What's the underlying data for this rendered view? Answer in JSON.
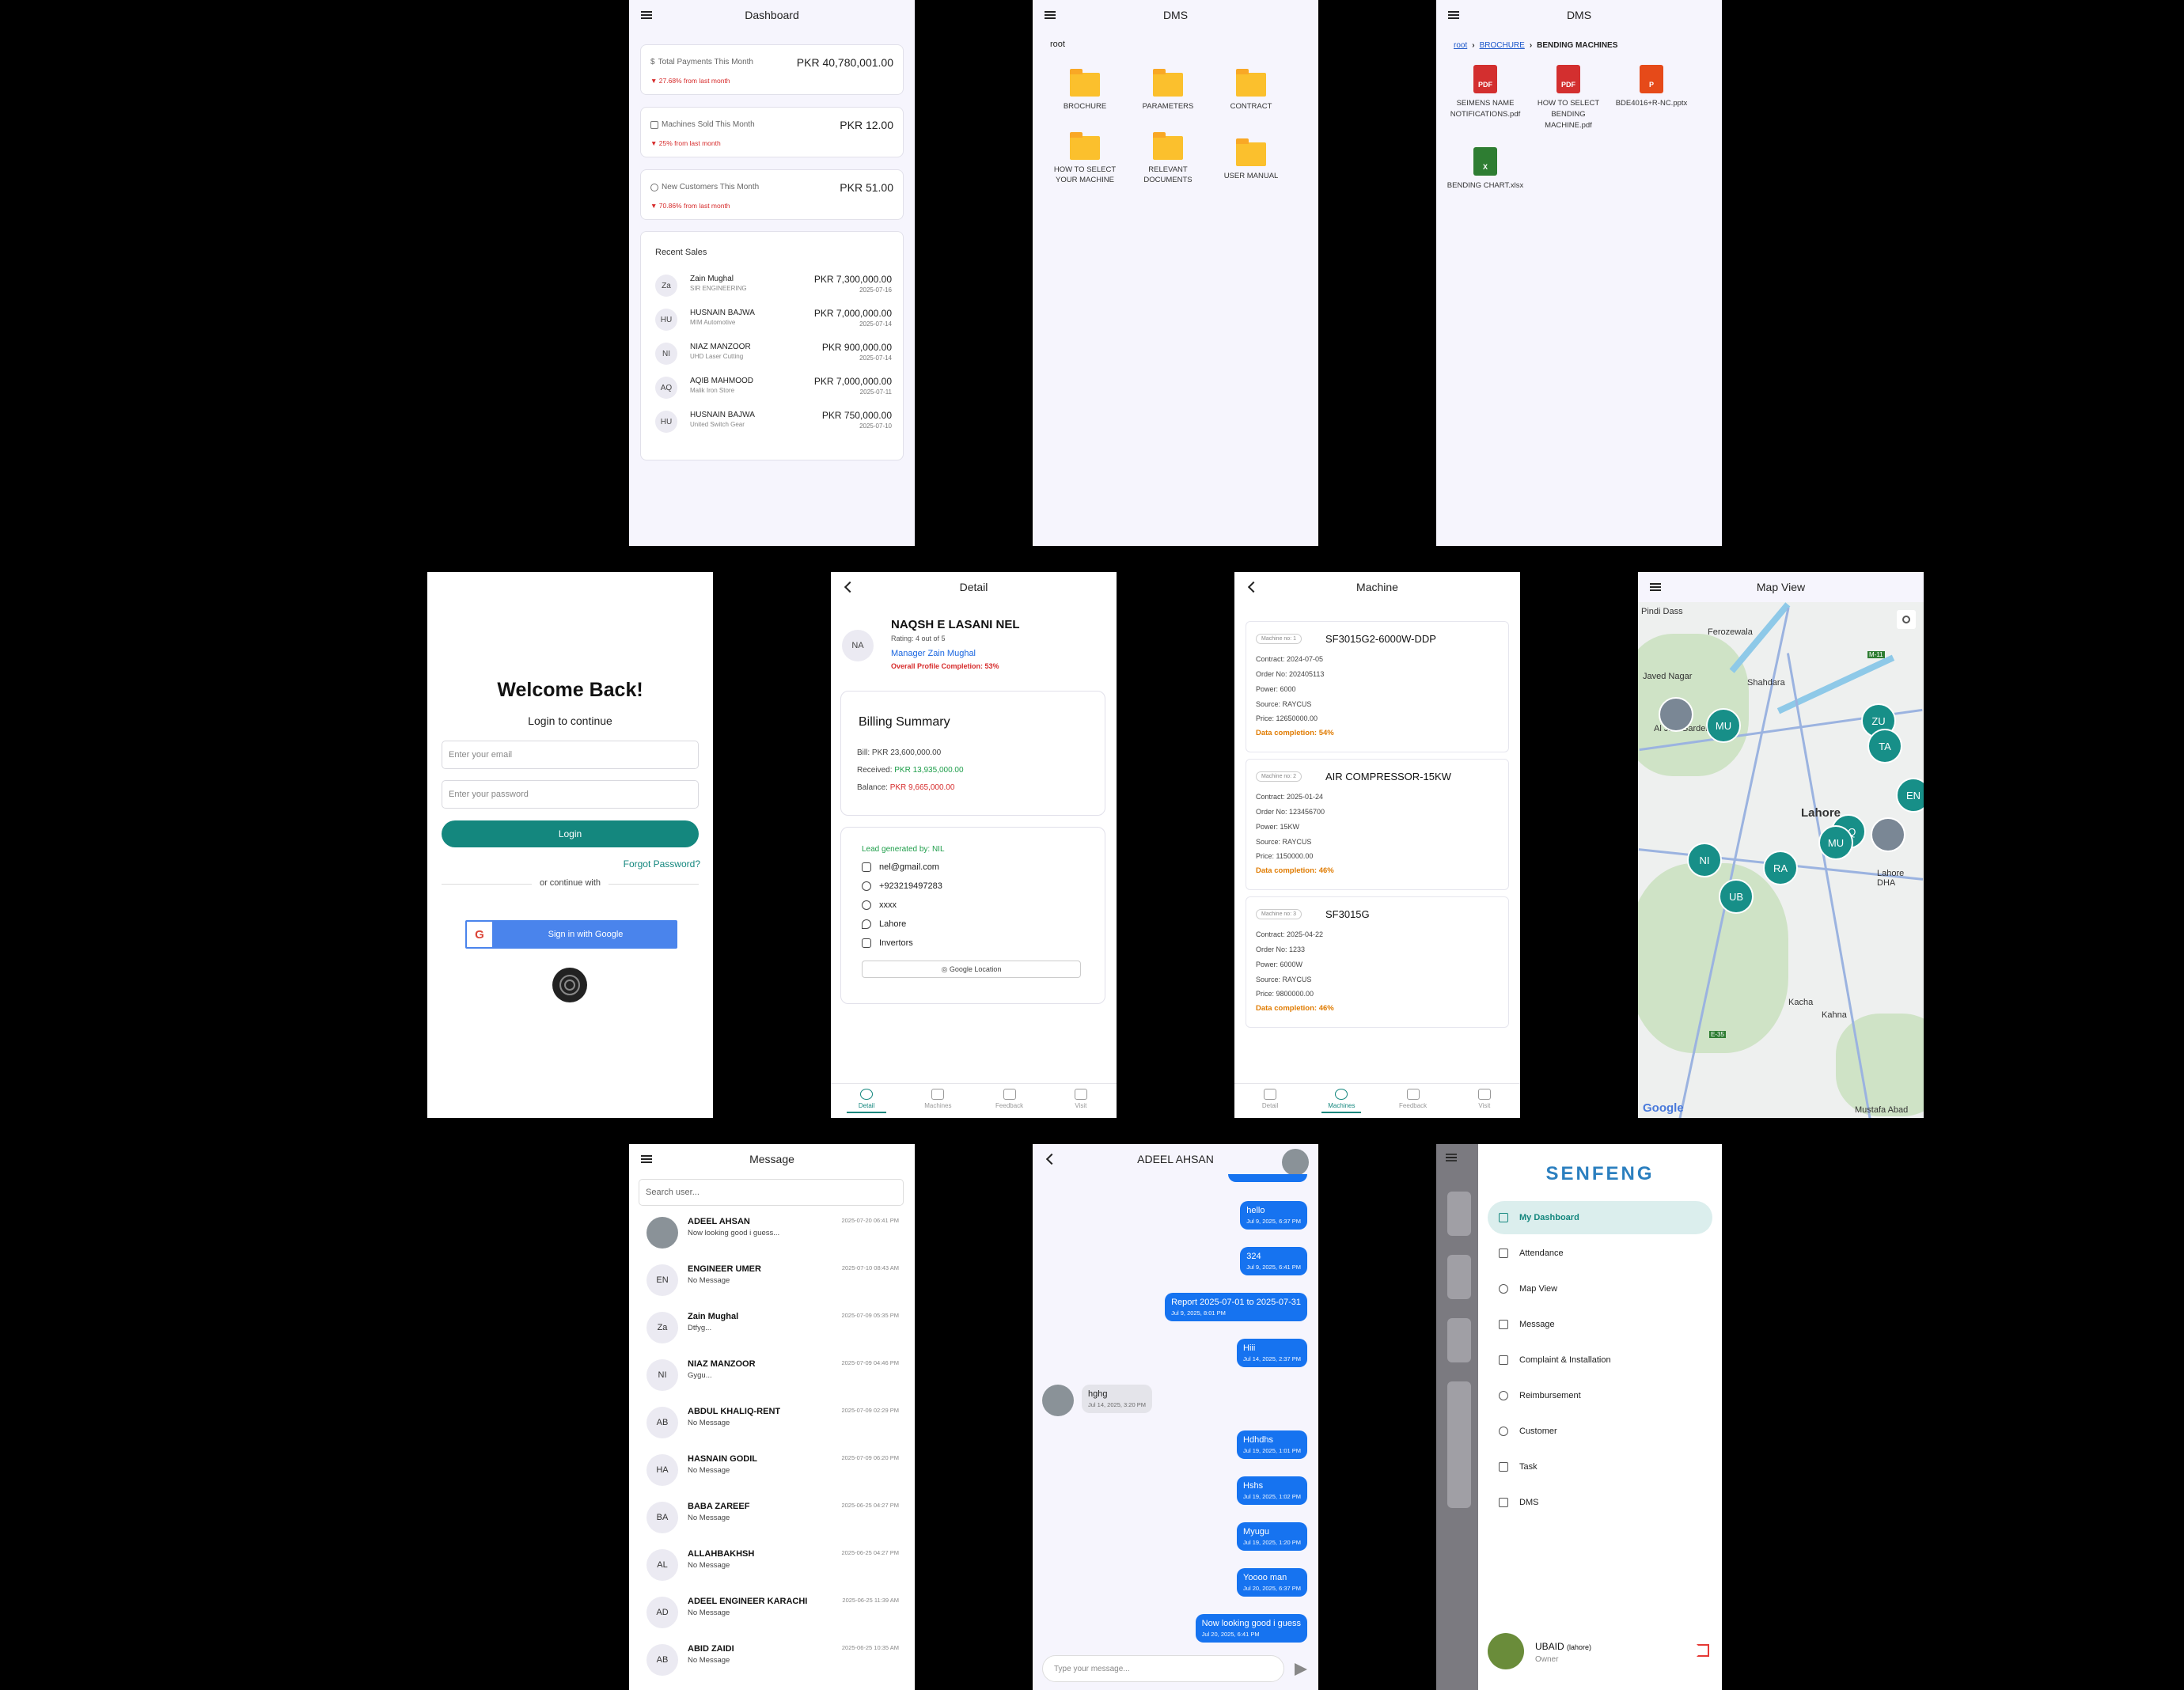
{
  "dashboard": {
    "title": "Dashboard",
    "stats": [
      {
        "label": "Total Payments This Month",
        "value": "PKR 40,780,001.00",
        "change": "▼ 27.68% from last month"
      },
      {
        "label": "Machines Sold This Month",
        "value": "PKR 12.00",
        "change": "▼ 25% from last month"
      },
      {
        "label": "New Customers This Month",
        "value": "PKR 51.00",
        "change": "▼ 70.86% from last month"
      }
    ],
    "recent_title": "Recent Sales",
    "sales": [
      {
        "initials": "Za",
        "name": "Zain Mughal",
        "company": "SIR ENGINEERING",
        "amount": "PKR 7,300,000.00",
        "date": "2025-07-16"
      },
      {
        "initials": "HU",
        "name": "HUSNAIN BAJWA",
        "company": "MIM Automotive",
        "amount": "PKR 7,000,000.00",
        "date": "2025-07-14"
      },
      {
        "initials": "NI",
        "name": "NIAZ MANZOOR",
        "company": "UHD Laser Cutting",
        "amount": "PKR 900,000.00",
        "date": "2025-07-14"
      },
      {
        "initials": "AQ",
        "name": "AQIB MAHMOOD",
        "company": "Malik Iron Store",
        "amount": "PKR 7,000,000.00",
        "date": "2025-07-11"
      },
      {
        "initials": "HU",
        "name": "HUSNAIN BAJWA",
        "company": "United Switch Gear",
        "amount": "PKR 750,000.00",
        "date": "2025-07-10"
      }
    ]
  },
  "dms_root": {
    "title": "DMS",
    "path": "root",
    "folders": [
      "BROCHURE",
      "PARAMETERS",
      "CONTRACT",
      "HOW TO SELECT YOUR MACHINE",
      "RELEVANT DOCUMENTS",
      "USER MANUAL"
    ]
  },
  "dms_folder": {
    "title": "DMS",
    "crumbs": [
      "root",
      "BROCHURE",
      "BENDING MACHINES"
    ],
    "files": [
      {
        "name": "SEIMENS NAME NOTIFICATIONS.pdf",
        "type": "PDF"
      },
      {
        "name": "HOW TO SELECT BENDING MACHINE.pdf",
        "type": "PDF"
      },
      {
        "name": "BDE4016+R-NC.pptx",
        "type": "P"
      },
      {
        "name": "BENDING CHART.xlsx",
        "type": "X"
      }
    ]
  },
  "login": {
    "heading": "Welcome Back!",
    "subheading": "Login to continue",
    "email_placeholder": "Enter your email",
    "password_placeholder": "Enter your password",
    "login_label": "Login",
    "forgot": "Forgot Password?",
    "or": "or continue with",
    "google": "Sign in with Google"
  },
  "detail": {
    "title": "Detail",
    "initials": "NA",
    "name": "NAQSH E LASANI NEL",
    "rating": "Rating: 4 out of 5",
    "manager": "Manager Zain Mughal",
    "completion": "Overall Profile Completion: 53%",
    "billing_title": "Billing Summary",
    "bill_label": "Bill:",
    "bill": "PKR 23,600,000.00",
    "received_label": "Received:",
    "received": "PKR 13,935,000.00",
    "balance_label": "Balance:",
    "balance": "PKR 9,665,000.00",
    "lead": "Lead generated by: NIL",
    "email": "nel@gmail.com",
    "phone": "+923219497283",
    "whatsapp": "xxxx",
    "city": "Lahore",
    "industry": "Invertors",
    "location_btn": "Google Location"
  },
  "tabs": [
    "Detail",
    "Machines",
    "Feedback",
    "Visit"
  ],
  "machines": {
    "title": "Machine",
    "items": [
      {
        "badge": "Machine no: 1",
        "name": "SF3015G2-6000W-DDP",
        "contract": "Contract: 2024-07-05",
        "order": "Order No: 202405113",
        "power": "Power: 6000",
        "source": "Source: RAYCUS",
        "price": "Price: 12650000.00",
        "completion": "Data completion: 54%"
      },
      {
        "badge": "Machine no: 2",
        "name": "AIR COMPRESSOR-15KW",
        "contract": "Contract: 2025-01-24",
        "order": "Order No: 123456700",
        "power": "Power: 15KW",
        "source": "Source: RAYCUS",
        "price": "Price: 1150000.00",
        "completion": "Data completion: 46%"
      },
      {
        "badge": "Machine no: 3",
        "name": "SF3015G",
        "contract": "Contract: 2025-04-22",
        "order": "Order No: 1233",
        "power": "Power: 6000W",
        "source": "Source: RAYCUS",
        "price": "Price: 9800000.00",
        "completion": "Data completion: 46%"
      }
    ]
  },
  "map": {
    "title": "Map View",
    "places": [
      "Pindi Dass",
      "Ferozewala",
      "Shahdara",
      "Javed Nagar",
      "Al Jalil Garden",
      "Lahore",
      "Lahore DHA",
      "Kacha",
      "Kahna",
      "Mustafa Abad",
      "M-11",
      "E-35"
    ],
    "pins": [
      "MU",
      "ZU",
      "TA",
      "EN",
      "AQ",
      "MU",
      "NI",
      "RA",
      "UB"
    ],
    "google": "Google"
  },
  "message": {
    "title": "Message",
    "search_placeholder": "Search user...",
    "chats": [
      {
        "initials": "",
        "name": "ADEEL AHSAN",
        "preview": "Now looking good i guess...",
        "time": "2025-07-20 06:41 PM"
      },
      {
        "initials": "EN",
        "name": "ENGINEER UMER",
        "preview": "No Message",
        "time": "2025-07-10 08:43 AM"
      },
      {
        "initials": "Za",
        "name": "Zain Mughal",
        "preview": "Dtfyg...",
        "time": "2025-07-09 05:35 PM"
      },
      {
        "initials": "NI",
        "name": "NIAZ MANZOOR",
        "preview": "Gygu...",
        "time": "2025-07-09 04:46 PM"
      },
      {
        "initials": "AB",
        "name": "ABDUL KHALIQ-RENT",
        "preview": "No Message",
        "time": "2025-07-09 02:29 PM"
      },
      {
        "initials": "HA",
        "name": "HASNAIN GODIL",
        "preview": "No Message",
        "time": "2025-07-09 06:20 PM"
      },
      {
        "initials": "BA",
        "name": "BABA ZAREEF",
        "preview": "No Message",
        "time": "2025-06-25 04:27 PM"
      },
      {
        "initials": "AL",
        "name": "ALLAHBAKHSH",
        "preview": "No Message",
        "time": "2025-06-25 04:27 PM"
      },
      {
        "initials": "AD",
        "name": "ADEEL ENGINEER KARACHI",
        "preview": "No Message",
        "time": "2025-06-25 11:39 AM"
      },
      {
        "initials": "AB",
        "name": "ABID ZAIDI",
        "preview": "No Message",
        "time": "2025-06-25 10:35 AM"
      }
    ]
  },
  "chat": {
    "title": "ADEEL AHSAN",
    "input_placeholder": "Type your message...",
    "messages": [
      {
        "text": "hello",
        "date": "Jul 9, 2025, 6:37 PM",
        "incoming": false
      },
      {
        "text": "324",
        "date": "Jul 9, 2025, 6:41 PM",
        "incoming": false
      },
      {
        "text": "Report 2025-07-01 to 2025-07-31",
        "date": "Jul 9, 2025, 8:01 PM",
        "incoming": false
      },
      {
        "text": "Hiii",
        "date": "Jul 14, 2025, 2:37 PM",
        "incoming": false
      },
      {
        "text": "hghg",
        "date": "Jul 14, 2025, 3:20 PM",
        "incoming": true
      },
      {
        "text": "Hdhdhs",
        "date": "Jul 19, 2025, 1:01 PM",
        "incoming": false
      },
      {
        "text": "Hshs",
        "date": "Jul 19, 2025, 1:02 PM",
        "incoming": false
      },
      {
        "text": "Myugu",
        "date": "Jul 19, 2025, 1:20 PM",
        "incoming": false
      },
      {
        "text": "Yoooo man",
        "date": "Jul 20, 2025, 6:37 PM",
        "incoming": false
      },
      {
        "text": "Now looking good i guess",
        "date": "Jul 20, 2025, 6:41 PM",
        "incoming": false
      }
    ]
  },
  "menu": {
    "brand": "SENFENG",
    "items": [
      "My Dashboard",
      "Attendance",
      "Map View",
      "Message",
      "Complaint & Installation",
      "Reimbursement",
      "Customer",
      "Task",
      "DMS"
    ],
    "user_name": "UBAID",
    "user_city": "(lahore)",
    "user_role": "Owner"
  },
  "colors": {
    "accent": "#14877e",
    "link": "#1a55c9",
    "bubble": "#1673f0",
    "brand": "#2b7fbf",
    "negative": "#d62b2b",
    "positive": "#1e9e4a",
    "warning": "#e07b00"
  }
}
